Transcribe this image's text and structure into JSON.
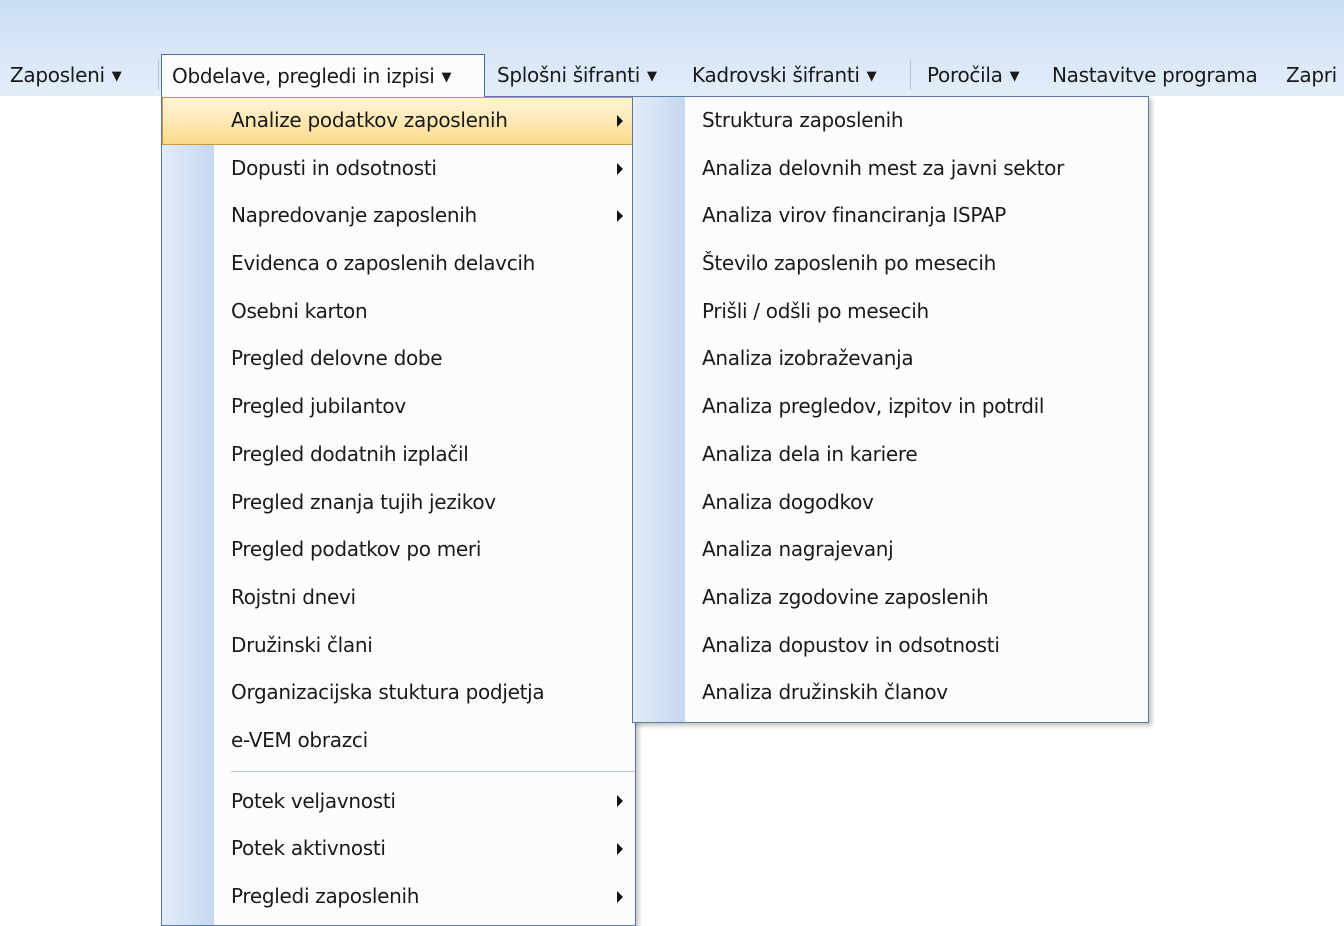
{
  "menubar": {
    "items": [
      {
        "label": "Zaposleni",
        "dropdown": true,
        "active": false
      },
      {
        "label": "Obdelave, pregledi in izpisi",
        "dropdown": true,
        "active": true
      },
      {
        "label": "Splošni šifranti",
        "dropdown": true,
        "active": false
      },
      {
        "label": "Kadrovski šifranti",
        "dropdown": true,
        "active": false
      },
      {
        "label": "Poročila",
        "dropdown": true,
        "active": false
      },
      {
        "label": "Nastavitve programa",
        "dropdown": false,
        "active": false
      },
      {
        "label": "Zapri",
        "dropdown": false,
        "active": false
      }
    ]
  },
  "main_menu": {
    "items": [
      {
        "label": "Analize podatkov zaposlenih",
        "submenu": true,
        "highlighted": true
      },
      {
        "label": "Dopusti in odsotnosti",
        "submenu": true
      },
      {
        "label": "Napredovanje zaposlenih",
        "submenu": true
      },
      {
        "label": "Evidenca o zaposlenih delavcih",
        "submenu": false
      },
      {
        "label": "Osebni karton",
        "submenu": false
      },
      {
        "label": "Pregled delovne dobe",
        "submenu": false
      },
      {
        "label": "Pregled jubilantov",
        "submenu": false
      },
      {
        "label": "Pregled dodatnih izplačil",
        "submenu": false
      },
      {
        "label": "Pregled znanja tujih jezikov",
        "submenu": false
      },
      {
        "label": "Pregled podatkov po meri",
        "submenu": false
      },
      {
        "label": "Rojstni dnevi",
        "submenu": false
      },
      {
        "label": "Družinski člani",
        "submenu": false
      },
      {
        "label": "Organizacijska stuktura podjetja",
        "submenu": false
      },
      {
        "label": "e-VEM obrazci",
        "submenu": false
      },
      {
        "label": "Potek veljavnosti",
        "submenu": true
      },
      {
        "label": "Potek aktivnosti",
        "submenu": true
      },
      {
        "label": "Pregledi zaposlenih",
        "submenu": true
      }
    ]
  },
  "sub_menu": {
    "items": [
      "Struktura zaposlenih",
      "Analiza delovnih mest za javni sektor",
      "Analiza virov financiranja ISPAP",
      "Število zaposlenih po mesecih",
      "Prišli / odšli po mesecih",
      "Analiza izobraževanja",
      "Analiza pregledov, izpitov in potrdil",
      "Analiza dela in kariere",
      "Analiza dogodkov",
      "Analiza nagrajevanj",
      "Analiza zgodovine zaposlenih",
      "Analiza dopustov in odsotnosti",
      "Analiza družinskih članov"
    ]
  },
  "icons": {
    "dropdown": "caret-down-icon",
    "submenu": "submenu-arrow-icon"
  },
  "colors": {
    "highlight": "#fbd98a",
    "menu_border": "#5b7aa3",
    "bar": "#d6e5f6"
  }
}
